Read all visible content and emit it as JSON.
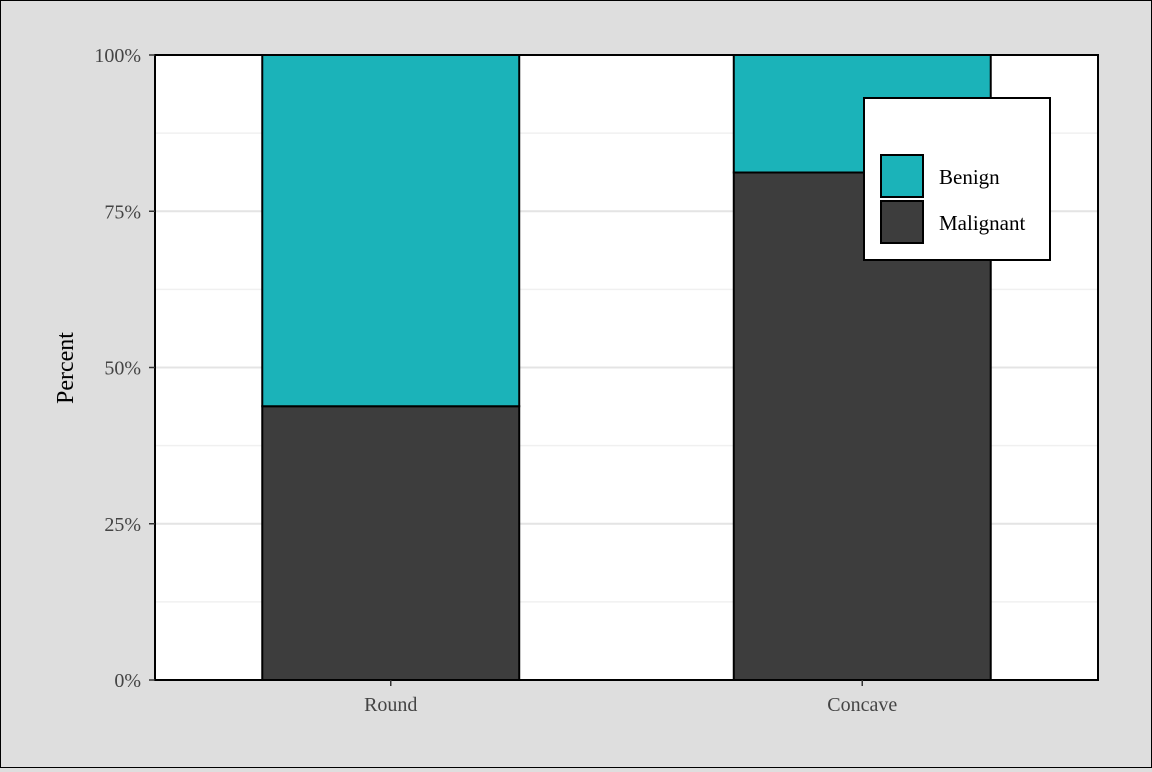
{
  "chart_data": {
    "type": "bar",
    "stacked": true,
    "categories": [
      "Round",
      "Concave"
    ],
    "series": [
      {
        "name": "Malignant",
        "color": "#3d3d3d",
        "values": [
          43.8,
          81.2
        ]
      },
      {
        "name": "Benign",
        "color": "#1bb3b9",
        "values": [
          56.2,
          18.8
        ]
      }
    ],
    "ylabel": "Percent",
    "xlabel": "",
    "ylim": [
      0,
      100
    ],
    "yticks": [
      "0%",
      "25%",
      "50%",
      "75%",
      "100%"
    ],
    "ytick_values": [
      0,
      25,
      50,
      75,
      100
    ],
    "grid": true,
    "legend": {
      "placement": "top-right",
      "items": [
        "Benign",
        "Malignant"
      ]
    },
    "background_color": "#dedede",
    "panel_color": "#ffffff"
  }
}
